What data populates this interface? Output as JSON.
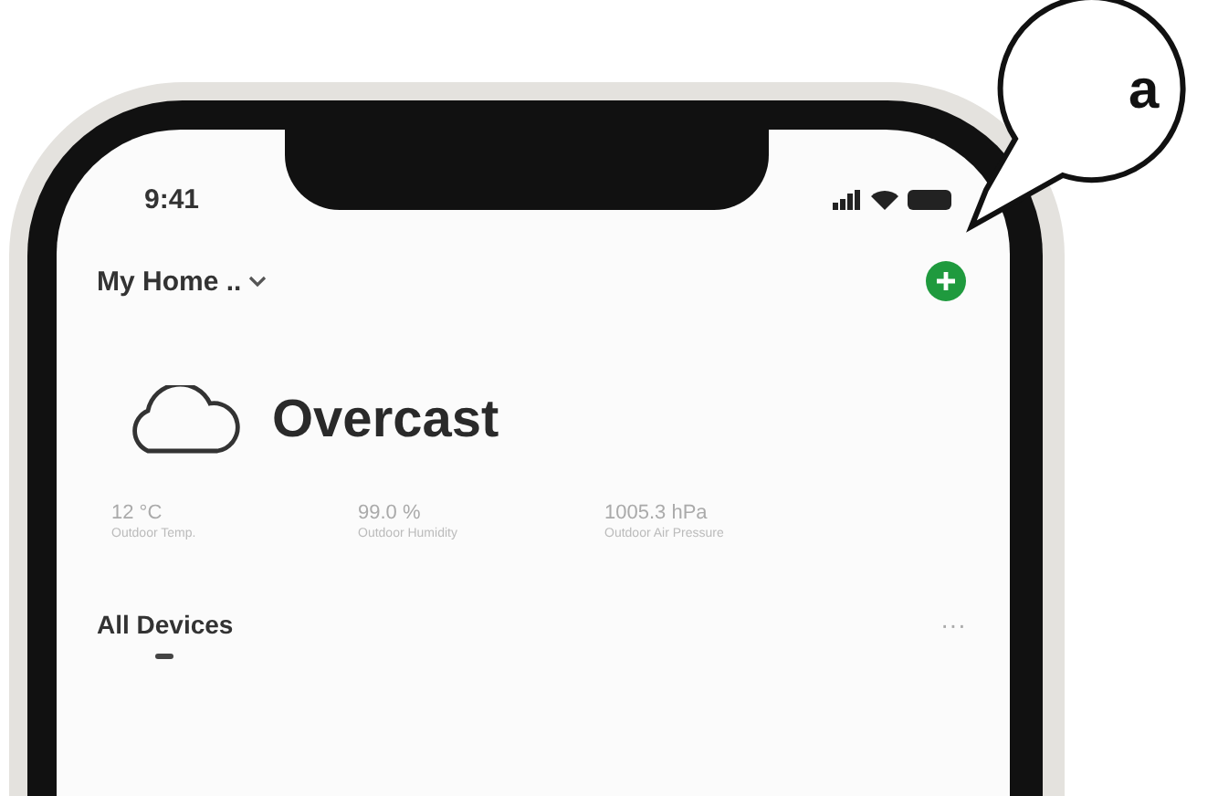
{
  "status_bar": {
    "time": "9:41"
  },
  "header": {
    "home": "My Home .."
  },
  "weather": {
    "condition": "Overcast",
    "stats": [
      {
        "value": "12 °C",
        "label": "Outdoor Temp."
      },
      {
        "value": "99.0 %",
        "label": "Outdoor Humidity"
      },
      {
        "value": "1005.3 hPa",
        "label": "Outdoor Air Pressure"
      }
    ]
  },
  "tabs": [
    {
      "label": "All Devices",
      "selected": true
    }
  ],
  "more": "···",
  "callout": {
    "label": "a"
  }
}
